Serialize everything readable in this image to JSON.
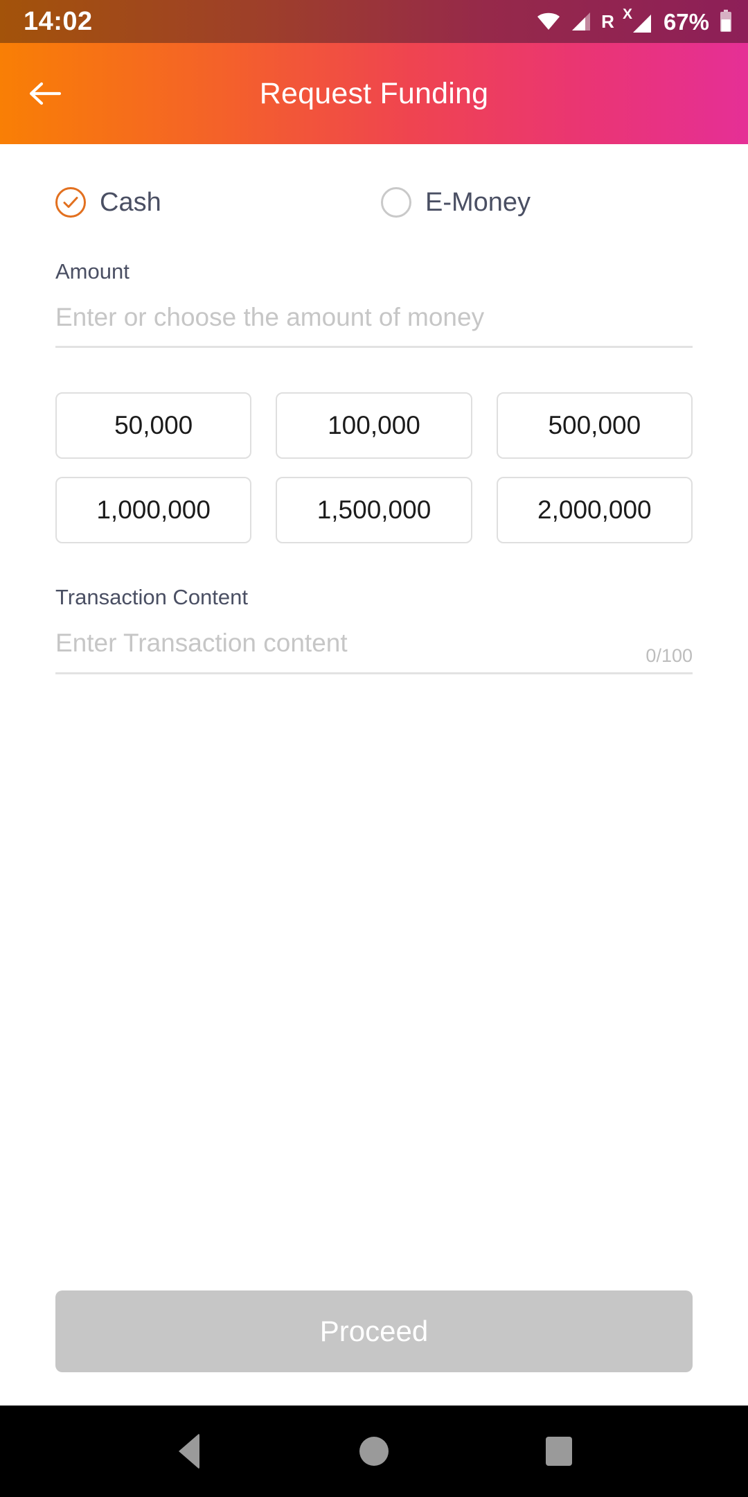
{
  "status_bar": {
    "time": "14:02",
    "roaming_label": "R",
    "sim_x_label": "X",
    "battery_percent": "67%",
    "icons": [
      "wifi-icon",
      "signal-icon",
      "roaming-icon",
      "sim-x-signal-icon",
      "battery-icon"
    ]
  },
  "app_bar": {
    "title": "Request Funding",
    "back_icon": "arrow-left-icon",
    "gradient_start": "#F97F05",
    "gradient_end": "#E52F96"
  },
  "payment_methods": {
    "options": [
      {
        "label": "Cash",
        "selected": true
      },
      {
        "label": "E-Money",
        "selected": false
      }
    ],
    "selected_color": "#E2701F",
    "unselected_color": "#C9C9C9"
  },
  "amount": {
    "label": "Amount",
    "value": "",
    "placeholder": "Enter or choose the amount of money",
    "presets": [
      "50,000",
      "100,000",
      "500,000",
      "1,000,000",
      "1,500,000",
      "2,000,000"
    ]
  },
  "transaction_content": {
    "label": "Transaction Content",
    "value": "",
    "placeholder": "Enter Transaction content",
    "counter": "0/100"
  },
  "footer": {
    "proceed_label": "Proceed",
    "proceed_enabled": false,
    "disabled_color": "#C6C6C6"
  },
  "nav_bar": {
    "back_icon": "nav-back-triangle-icon",
    "home_icon": "nav-home-circle-icon",
    "recents_icon": "nav-recents-square-icon"
  }
}
